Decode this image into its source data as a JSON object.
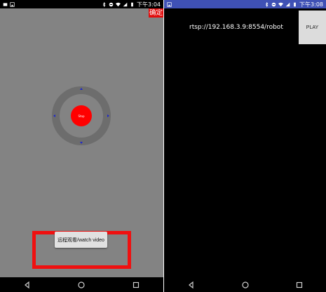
{
  "left_screen": {
    "status_bar": {
      "time": "下午3:04",
      "icons": [
        "notification-icon",
        "image-icon",
        "bluetooth-icon",
        "do-not-disturb-icon",
        "wifi-icon",
        "signal-icon",
        "battery-icon"
      ]
    },
    "confirm_button": {
      "label": "确定",
      "color": "#e20c0c"
    },
    "joystick": {
      "center_label": "Stop",
      "knob_color": "#ff0000",
      "arrow_color": "#1f28c9"
    },
    "watch_button": {
      "label": "远程观看/watch video"
    },
    "highlight_color": "#f01010",
    "background": "#838383"
  },
  "right_screen": {
    "status_bar": {
      "time": "下午3:08",
      "background": "#3f51b5",
      "icons": [
        "image-icon",
        "bluetooth-icon",
        "do-not-disturb-icon",
        "wifi-icon",
        "signal-icon",
        "battery-icon"
      ]
    },
    "stream_url": "rtsp://192.168.3.9:8554/robot",
    "play_button": {
      "label": "PLAY"
    }
  },
  "nav_bar": {
    "keys": [
      "back-icon",
      "home-icon",
      "recents-icon"
    ]
  }
}
